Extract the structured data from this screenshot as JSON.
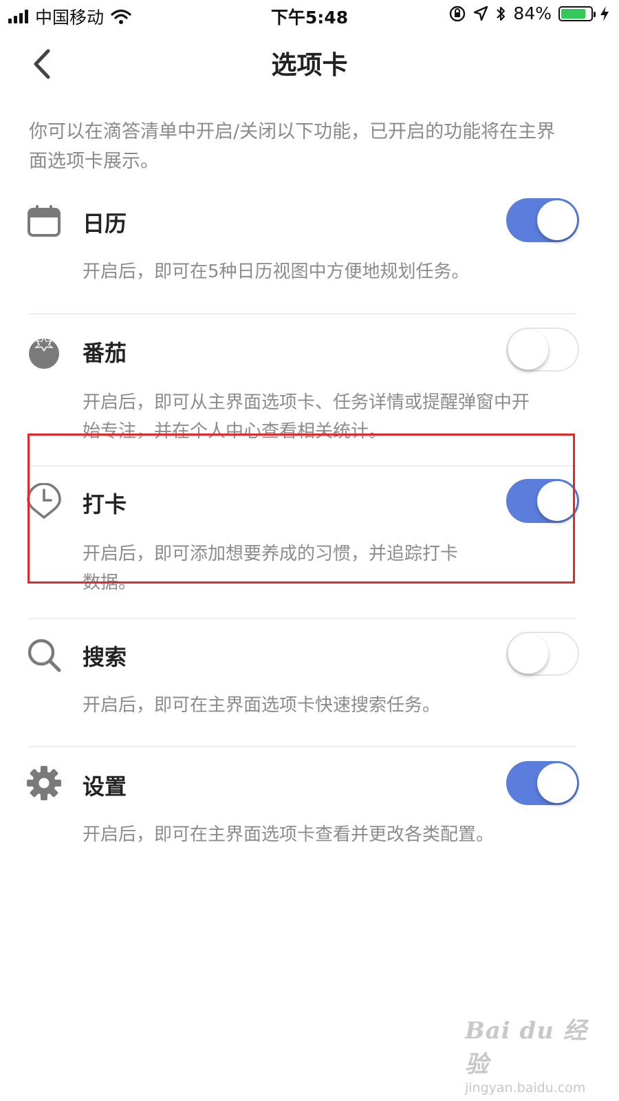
{
  "status_bar": {
    "carrier": "中国移动",
    "time": "下午5:48",
    "battery_percent": "84%",
    "battery_level": 0.84,
    "battery_color": "#34c759"
  },
  "nav": {
    "back_icon": "chevron-left-icon",
    "title": "选项卡"
  },
  "intro": "你可以在滴答清单中开启/关闭以下功能，已开启的功能将在主界面选项卡展示。",
  "accent_color": "#5b7ddb",
  "features": [
    {
      "icon": "calendar-icon",
      "title": "日历",
      "desc": "开启后，即可在5种日历视图中方便地规划任务。",
      "enabled": true
    },
    {
      "icon": "pomodoro-icon",
      "title": "番茄",
      "desc": "开启后，即可从主界面选项卡、任务详情或提醒弹窗中开始专注，并在个人中心查看相关统计。",
      "enabled": false
    },
    {
      "icon": "clock-icon",
      "title": "打卡",
      "desc": "开启后，即可添加想要养成的习惯，并追踪打卡数据。",
      "enabled": true
    },
    {
      "icon": "search-icon",
      "title": "搜索",
      "desc": "开启后，即可在主界面选项卡快速搜索任务。",
      "enabled": false
    },
    {
      "icon": "gear-icon",
      "title": "设置",
      "desc": "开启后，即可在主界面选项卡查看并更改各类配置。",
      "enabled": true
    }
  ],
  "highlight_color": "#e02a2a",
  "watermark": {
    "logo": "Bai du 经验",
    "url": "jingyan.baidu.com"
  }
}
